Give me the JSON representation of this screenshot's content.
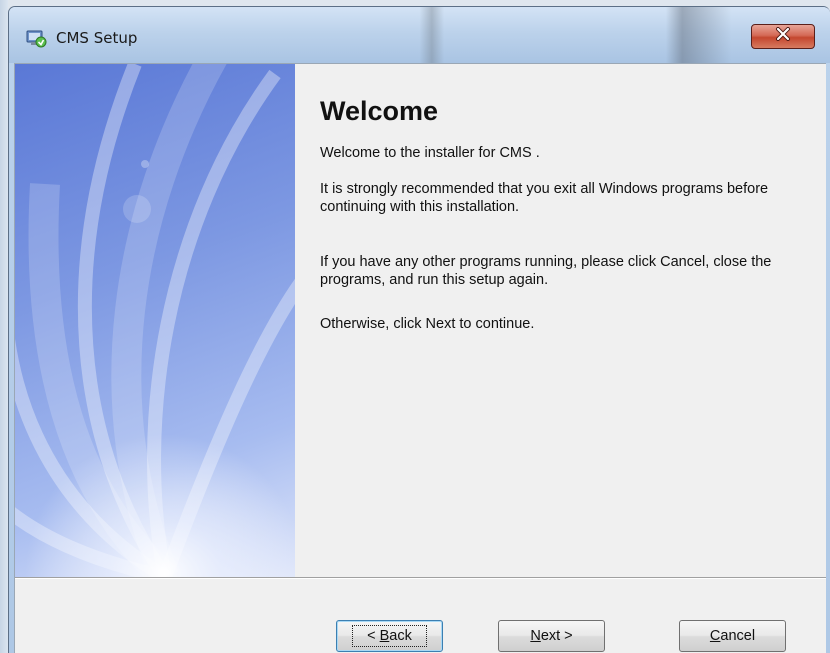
{
  "window": {
    "title": "CMS Setup",
    "icon": "installer-icon",
    "close_icon": "close-icon",
    "accent_close": "#c4472f"
  },
  "page": {
    "heading": "Welcome",
    "paragraphs": [
      "Welcome to the installer for CMS .",
      "It is strongly recommended that you exit all Windows programs before continuing with this installation.",
      "If you have any other programs running, please click Cancel, close the programs, and run this setup again.",
      "Otherwise, click Next to continue."
    ]
  },
  "buttons": {
    "back": {
      "pre": "< ",
      "mnemonic": "B",
      "rest": "ack"
    },
    "next": {
      "mnemonic": "N",
      "rest": "ext >"
    },
    "cancel": {
      "mnemonic": "C",
      "rest": "ancel"
    }
  }
}
